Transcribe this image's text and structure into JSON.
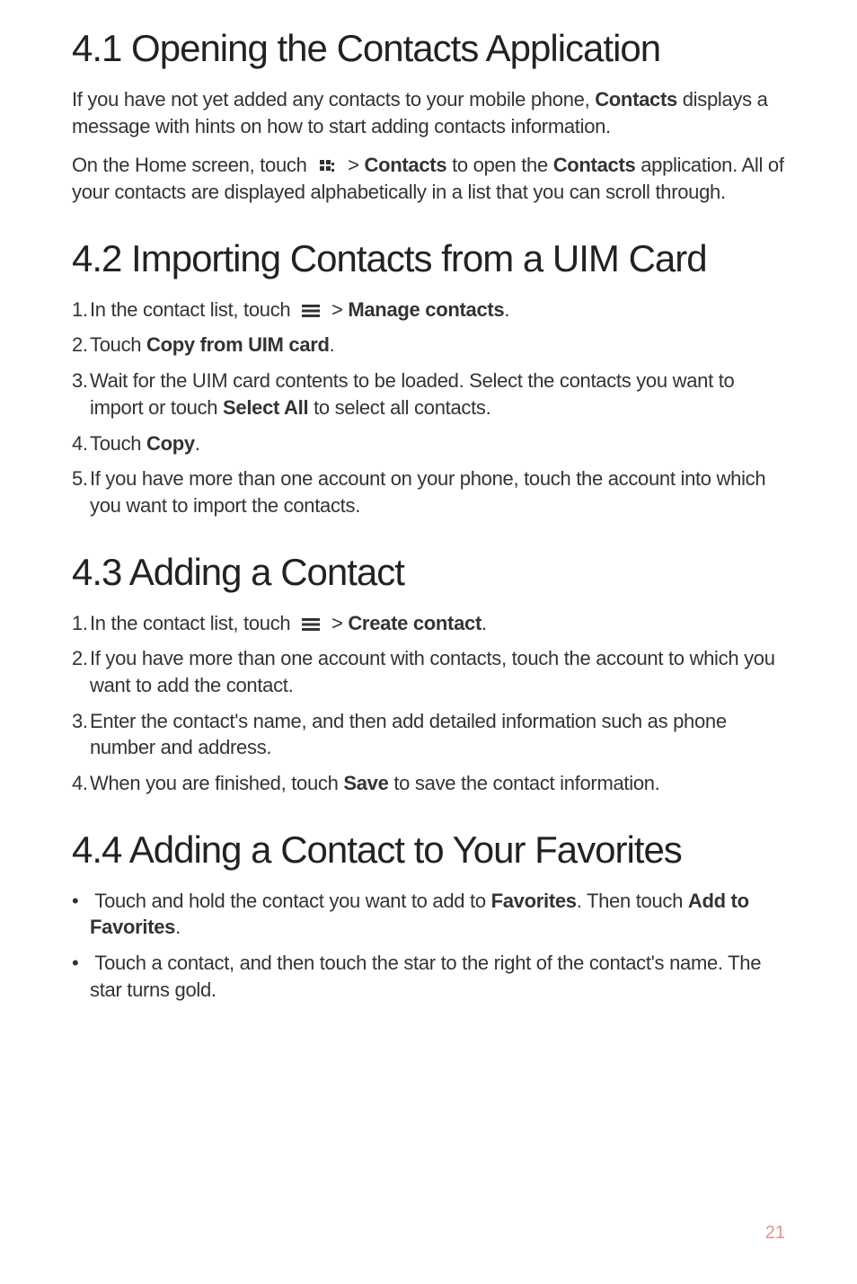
{
  "sections": {
    "s1": {
      "heading": "4.1  Opening the Contacts Application",
      "p1_a": "If you have not yet added any contacts to your mobile phone, ",
      "p1_b": "Contacts",
      "p1_c": " displays a message with hints on how to start adding contacts information.",
      "p2_a": "On the Home screen, touch ",
      "p2_b": " > ",
      "p2_c": "Contacts",
      "p2_d": " to open the ",
      "p2_e": "Contacts",
      "p2_f": " application. All of your contacts are displayed alphabetically in a list that you can scroll through."
    },
    "s2": {
      "heading": "4.2  Importing Contacts from a UIM Card",
      "li1_a": "In the contact list, touch ",
      "li1_b": " > ",
      "li1_c": "Manage contacts",
      "li1_d": ".",
      "li2_a": "Touch ",
      "li2_b": "Copy from UIM card",
      "li2_c": ".",
      "li3_a": "Wait for the UIM card contents to be loaded. Select the contacts you want to import or touch ",
      "li3_b": "Select All",
      "li3_c": " to select all contacts.",
      "li4_a": "Touch ",
      "li4_b": "Copy",
      "li4_c": ".",
      "li5": "If you have more than one account on your phone, touch the account into which you want to import the contacts."
    },
    "s3": {
      "heading": "4.3  Adding a Contact",
      "li1_a": "In the contact list, touch ",
      "li1_b": " > ",
      "li1_c": "Create contact",
      "li1_d": ".",
      "li2": "If you have more than one account with contacts, touch the account to which you want to add the contact.",
      "li3": "Enter the contact's name, and then add detailed information such as phone number and address.",
      "li4_a": "When you are finished, touch ",
      "li4_b": "Save",
      "li4_c": " to save the contact information."
    },
    "s4": {
      "heading": "4.4  Adding a Contact to Your Favorites",
      "li1_a": "Touch and hold the contact you want to add to ",
      "li1_b": "Favorites",
      "li1_c": ". Then touch ",
      "li1_d": "Add to Favorites",
      "li1_e": ".",
      "li2": "Touch a contact, and then touch the star to the right of the contact's name. The star turns gold."
    }
  },
  "numbers": {
    "n1": "1. ",
    "n2": "2. ",
    "n3": "3. ",
    "n4": "4. ",
    "n5": "5. "
  },
  "page_number": "21"
}
